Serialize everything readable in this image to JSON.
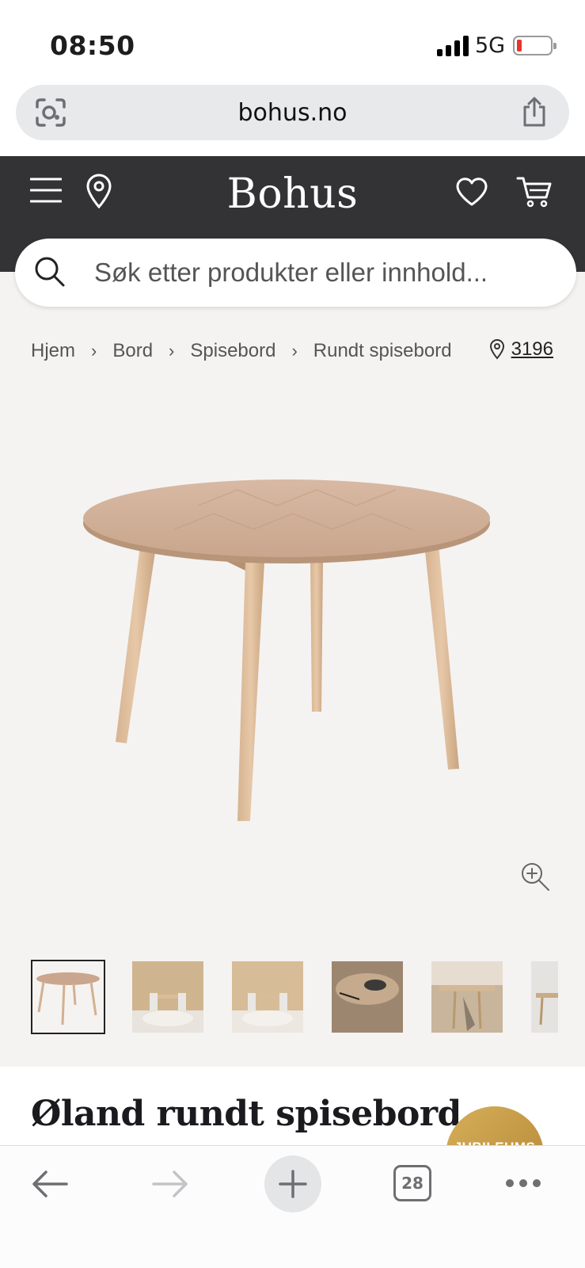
{
  "status_bar": {
    "time": "08:50",
    "network": "5G",
    "battery_level": 0.1,
    "battery_color": "#e5352d"
  },
  "browser": {
    "url": "bohus.no",
    "lens_icon": "lens-icon",
    "share_icon": "share-icon"
  },
  "header": {
    "logo": "Bohus",
    "background": "#333335",
    "icons": [
      "menu-icon",
      "location-pin-icon",
      "heart-icon",
      "cart-icon"
    ]
  },
  "search": {
    "placeholder": "Søk etter produkter eller innhold..."
  },
  "breadcrumb": {
    "items": [
      "Hjem",
      "Bord",
      "Spisebord",
      "Rundt spisebord"
    ],
    "location_code": "3196"
  },
  "gallery": {
    "thumbnail_count": 6,
    "active_index": 0
  },
  "product": {
    "title": "Øland rundt spisebord",
    "badge": "JUBILEUMS"
  },
  "toolbar": {
    "tab_count": "28",
    "icons": [
      "back-arrow-icon",
      "forward-arrow-icon",
      "plus-icon",
      "tabs-icon",
      "more-icon"
    ]
  }
}
